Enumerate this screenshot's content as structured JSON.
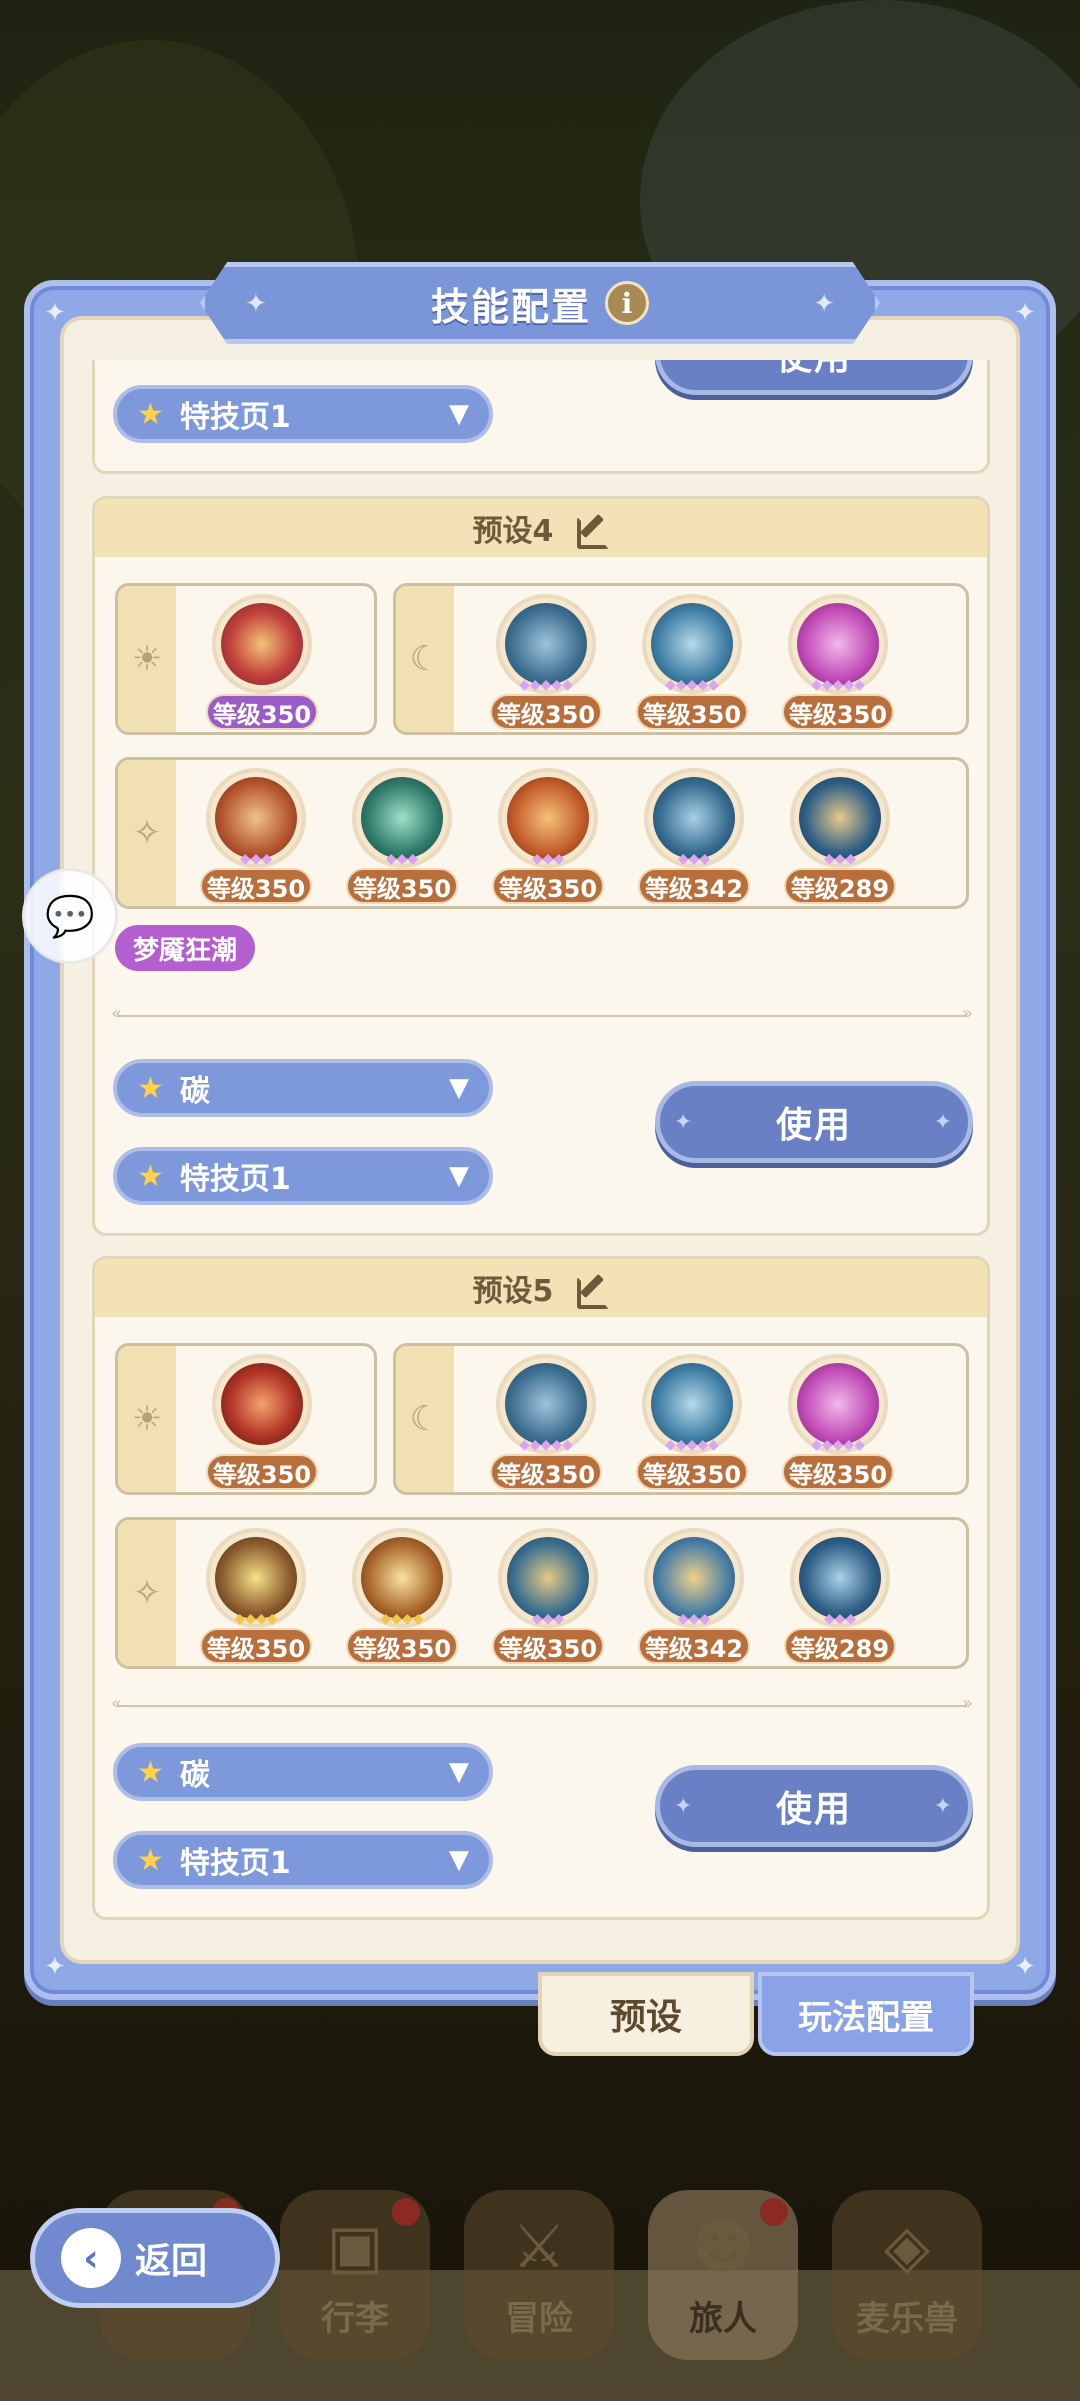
{
  "dialog": {
    "title": "技能配置"
  },
  "top_card": {
    "page_select": "特技页1",
    "use_label": "使用"
  },
  "presets": [
    {
      "name": "预设4",
      "sun_skills": [
        {
          "level": "等级350",
          "color": "#c2413a",
          "badge": "purple"
        }
      ],
      "moon_skills": [
        {
          "level": "等级350",
          "color": "#3d6e8f"
        },
        {
          "level": "等级350",
          "color": "#3f7ea3"
        },
        {
          "level": "等级350",
          "color": "#c04ab6"
        }
      ],
      "star_skills": [
        {
          "level": "等级350",
          "color": "#b4542f"
        },
        {
          "level": "等级350",
          "color": "#2f7a6a"
        },
        {
          "level": "等级350",
          "color": "#c25c2a"
        },
        {
          "level": "等级342",
          "color": "#356b8f"
        },
        {
          "level": "等级289",
          "color": "#2f5f86"
        }
      ],
      "tag": "梦魇狂潮",
      "element_select": "碳",
      "page_select": "特技页1",
      "use_label": "使用"
    },
    {
      "name": "预设5",
      "sun_skills": [
        {
          "level": "等级350",
          "color": "#b23527",
          "badge": "brown"
        }
      ],
      "moon_skills": [
        {
          "level": "等级350",
          "color": "#3d6e8f"
        },
        {
          "level": "等级350",
          "color": "#3f7ea3"
        },
        {
          "level": "等级350",
          "color": "#c04ab6"
        }
      ],
      "star_skills": [
        {
          "level": "等级350",
          "color": "#8a5a2c"
        },
        {
          "level": "等级350",
          "color": "#a8642a"
        },
        {
          "level": "等级350",
          "color": "#3a6f8f"
        },
        {
          "level": "等级342",
          "color": "#4a7fa6"
        },
        {
          "level": "等级289",
          "color": "#2f5f86"
        }
      ],
      "element_select": "碳",
      "page_select": "特技页1",
      "use_label": "使用"
    }
  ],
  "tabs": {
    "preset": "预设",
    "gameplay": "玩法配置"
  },
  "nav": {
    "back": "返回",
    "luggage": "行李",
    "adventure": "冒险",
    "traveler": "旅人",
    "mailebeast": "麦乐兽"
  },
  "icons": {
    "sun": "sun-icon",
    "moon": "moon-icon",
    "star": "sparkle-icon",
    "chat": "chat-icon"
  }
}
